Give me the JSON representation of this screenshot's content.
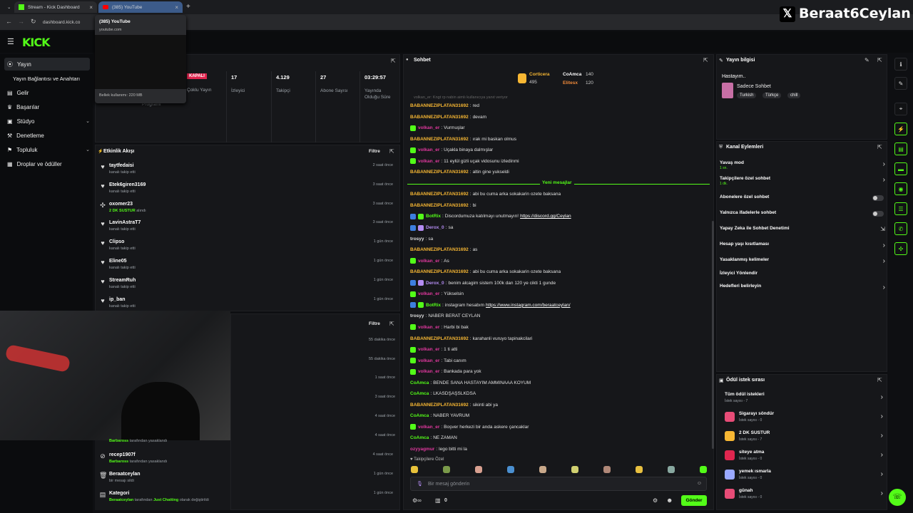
{
  "browser": {
    "tab1": "Stream - Kick Dashboard",
    "tab2": "(385) YouTube",
    "url": "dashboard.kick.co",
    "hover_card": {
      "title": "(385) YouTube",
      "domain": "youtube.com",
      "memory": "Bellek kullanımı: 220 MB"
    }
  },
  "overlay_name": "Beraat6Ceylan",
  "sidebar": {
    "items": [
      {
        "label": "Yayın",
        "icon": "broadcast-icon"
      },
      {
        "label": "Yayın Bağlantısı ve Anahtarı"
      },
      {
        "label": "Gelir",
        "icon": "money-icon"
      },
      {
        "label": "Başarılar",
        "icon": "trophy-icon"
      },
      {
        "label": "Stüdyo",
        "icon": "studio-icon"
      },
      {
        "label": "Denetleme",
        "icon": "moderation-icon"
      },
      {
        "label": "Topluluk",
        "icon": "community-icon"
      },
      {
        "label": "Droplar ve ödüller",
        "icon": "gift-icon"
      }
    ]
  },
  "stream_stats": {
    "status": "KAPALI",
    "status_label": "Çoklu Yayın",
    "program": "Programı",
    "items": [
      {
        "value": "17",
        "label": "İzleyici"
      },
      {
        "value": "4.129",
        "label": "Takipçi"
      },
      {
        "value": "27",
        "label": "Abone Sayısı"
      },
      {
        "value": "03:29:57",
        "label": "Yayında Olduğu Süre"
      }
    ]
  },
  "activity": {
    "title": "Etkinlik Akışı",
    "filter": "Filtre",
    "items": [
      {
        "name": "taytfedaisi",
        "desc": "kanalı takip etti",
        "time": "2 saat önce"
      },
      {
        "name": "Etek6giren3169",
        "desc": "kanalı takip etti",
        "time": "3 saat önce"
      },
      {
        "name": "oxomer23",
        "desc_hl": "2 DK SUSTUR",
        "desc": "alındı",
        "time": "3 saat önce"
      },
      {
        "name": "LavinAstraT7",
        "desc": "kanalı takip etti",
        "time": "3 saat önce"
      },
      {
        "name": "Clipso",
        "desc": "kanalı takip etti",
        "time": "1 gün önce"
      },
      {
        "name": "Eline05",
        "desc": "kanalı takip etti",
        "time": "1 gün önce"
      },
      {
        "name": "StreamRuh",
        "desc": "kanalı takip etti",
        "time": "1 gün önce"
      },
      {
        "name": "ip_ban",
        "desc": "kanalı takip etti",
        "time": "1 gün önce"
      }
    ]
  },
  "modlog": {
    "filter": "Filtre",
    "times": [
      "55 dakika önce",
      "55 dakika önce",
      "1 saat önce",
      "3 saat önce",
      "4 saat önce",
      "4 saat önce"
    ],
    "items": [
      {
        "user": "Barbaross",
        "desc": "tarafından yasaklandı",
        "time": "4 saat önce",
        "name": ""
      },
      {
        "name": "recep1907f",
        "user": "Barbaross",
        "desc": "tarafından yasaklandı",
        "time": "4 saat önce"
      },
      {
        "name": "Beraatceylan",
        "desc": "bir mesajı sildi",
        "time": "1 gün önce"
      },
      {
        "name": "Kategori",
        "user": "Beraatceylan",
        "desc": "tarafından",
        "cat": "Just Chatting",
        "desc2": "olarak değiştirildi",
        "time": "1 gün önce"
      }
    ]
  },
  "chat": {
    "title": "Sohbet",
    "new_messages": "Yeni mesajlar",
    "top": [
      {
        "name": "Corticera",
        "value": "495"
      },
      {
        "name": "CoAmca",
        "value": "140"
      },
      {
        "name": "Elitesx",
        "value": "120"
      }
    ],
    "truncated": "volkan_er: Kngt rp nabin aimlı kullanıcıya yanıt veriyor",
    "messages": [
      {
        "u": "BABANNEZIPLATAN31692",
        "c": "#f7b733",
        "t": "red"
      },
      {
        "u": "BABANNEZIPLATAN31692",
        "c": "#f7b733",
        "t": "devam"
      },
      {
        "u": "volkan_er",
        "c": "#e0389e",
        "t": "Vurmuşlar",
        "b": "g"
      },
      {
        "u": "BABANNEZIPLATAN31692",
        "c": "#f7b733",
        "t": "ırak mi baskan olmus"
      },
      {
        "u": "volkan_er",
        "c": "#e0389e",
        "t": "Uçakla binaya dalmışlar",
        "b": "g"
      },
      {
        "u": "volkan_er",
        "c": "#e0389e",
        "t": "11 eylül gizli uçak vidosunu izledinmi",
        "b": "g"
      },
      {
        "u": "BABANNEZIPLATAN31692",
        "c": "#f7b733",
        "t": "altin gine yukseldi"
      },
      {
        "sep": true
      },
      {
        "u": "BABANNEZIPLATAN31692",
        "c": "#f7b733",
        "t": "abi bu cuma arka sokakarin ozete baksana"
      },
      {
        "u": "BABANNEZIPLATAN31692",
        "c": "#f7b733",
        "t": "bi"
      },
      {
        "u": "BotRix",
        "c": "#53fc18",
        "t": "Discordumuza katılmayı unutmayın! ",
        "link": "https://discord.gg/Ceylan",
        "b": "b"
      },
      {
        "u": "Derox_0",
        "c": "#b48cf2",
        "t": "sa",
        "b": "b"
      },
      {
        "u": "trosyy",
        "c": "#e0e0e0",
        "t": "sa"
      },
      {
        "u": "BABANNEZIPLATAN31692",
        "c": "#f7b733",
        "t": "as"
      },
      {
        "u": "volkan_er",
        "c": "#e0389e",
        "t": "As",
        "b": "g"
      },
      {
        "u": "BABANNEZIPLATAN31692",
        "c": "#f7b733",
        "t": "abi bu cuma arka sokakarin ozete baksana"
      },
      {
        "u": "Derox_0",
        "c": "#b48cf2",
        "t": "benim alcagim sistem 100k dan 120 ye cikti 1 gunde",
        "b": "b"
      },
      {
        "u": "volkan_er",
        "c": "#e0389e",
        "t": "Yükselsin",
        "b": "g"
      },
      {
        "u": "BotRix",
        "c": "#53fc18",
        "t": "instagram hesabım ",
        "link": "https://www.instagram.com/beraatceylan/",
        "b": "b"
      },
      {
        "u": "trosyy",
        "c": "#e0e0e0",
        "t": "NABER BERAT CEYLAN"
      },
      {
        "u": "volkan_er",
        "c": "#e0389e",
        "t": "Harbi bi bak",
        "b": "g"
      },
      {
        "u": "BABANNEZIPLATAN31692",
        "c": "#f7b733",
        "t": "karahanli vuruyo tapinakcilari"
      },
      {
        "u": "volkan_er",
        "c": "#e0389e",
        "t": "1 ti atti",
        "b": "g"
      },
      {
        "u": "volkan_er",
        "c": "#e0389e",
        "t": "Tabi canım",
        "b": "g"
      },
      {
        "u": "volkan_er",
        "c": "#e0389e",
        "t": "Bankada para yok",
        "b": "g"
      },
      {
        "u": "CoAmca",
        "c": "#53fc18",
        "t": "BENDE SANA HASTAYIM AMMINAAA KOYUM"
      },
      {
        "u": "CoAmca",
        "c": "#53fc18",
        "t": "LKASDŞAŞSLKDSA"
      },
      {
        "u": "BABANNEZIPLATAN31692",
        "c": "#f7b733",
        "t": "sikinti abi ya"
      },
      {
        "u": "CoAmca",
        "c": "#53fc18",
        "t": "NABER YAVRUM"
      },
      {
        "u": "volkan_er",
        "c": "#e0389e",
        "t": "Boşver herkezi bir anda askere çancaklar",
        "b": "g"
      },
      {
        "u": "CoAmca",
        "c": "#53fc18",
        "t": "NE ZAMAN"
      },
      {
        "u": "ozyyagmur",
        "c": "#e0389e",
        "t": "lego bitti mi la"
      }
    ],
    "followers_only": "Takipçilere Özel",
    "placeholder": "Bir mesaj gönderin",
    "send": "Gönder",
    "count": "0"
  },
  "stream_info": {
    "title": "Yayın bilgisi",
    "stream_title": "Hastayım..",
    "category": "Sadece Sohbet",
    "tags": [
      "Turkish",
      "Türkçe",
      "chill"
    ]
  },
  "channel_actions": {
    "title": "Kanal Eylemleri",
    "items": [
      {
        "label": "Yavaş mod",
        "sub": "1 sn.",
        "type": "arrow"
      },
      {
        "label": "Takipçilere özel sohbet",
        "sub": "1 dk.",
        "type": "arrow"
      },
      {
        "label": "Abonelere özel sohbet",
        "type": "toggle"
      },
      {
        "label": "Yalnızca ifadelerle sohbet",
        "type": "toggle"
      },
      {
        "label": "Yapay Zeka ile Sohbet Denetimi",
        "type": "ext"
      },
      {
        "label": "Hesap yaşı kısıtlaması",
        "type": "arrow"
      },
      {
        "label": "Yasaklanmış kelimeler",
        "type": "arrow"
      },
      {
        "label": "İzleyici Yönlendir",
        "type": "none"
      },
      {
        "label": "Hedefleri belirleyin",
        "type": "arrow"
      }
    ]
  },
  "rewards": {
    "title": "Ödül istek sırası",
    "all": "Tüm ödül istekleri",
    "all_sub": "İstek sayısı - 7",
    "items": [
      {
        "label": "Sigarayı söndür",
        "sub": "İstek sayısı - 0",
        "color": "#e74c77"
      },
      {
        "label": "2 DK SUSTUR",
        "sub": "İstek sayısı - 7",
        "color": "#f7b733"
      },
      {
        "label": "siteye atma",
        "sub": "İstek sayısı - 0",
        "color": "#e0264f"
      },
      {
        "label": "yemek ısmarla",
        "sub": "İstek sayısı - 0",
        "color": "#9aa8ff"
      },
      {
        "label": "günah",
        "sub": "İstek sayısı - 0",
        "color": "#e74c77"
      }
    ]
  }
}
